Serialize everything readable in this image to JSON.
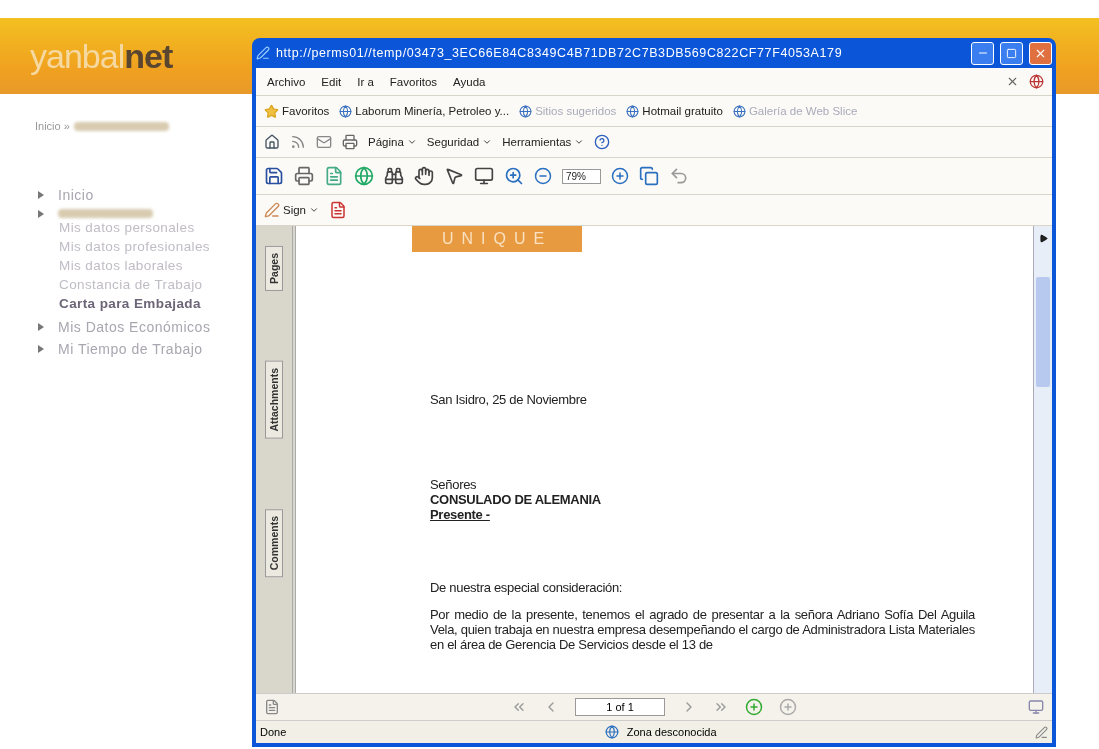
{
  "header": {
    "logo_light": "yanbal",
    "logo_bold": "net"
  },
  "breadcrumb": "Inicio »",
  "nav": [
    {
      "kind": "section",
      "label": "Inicio"
    },
    {
      "kind": "redacted",
      "children": [
        {
          "label": "Mis datos personales",
          "selected": false
        },
        {
          "label": "Mis datos profesionales",
          "selected": false
        },
        {
          "label": "Mis datos laborales",
          "selected": false
        },
        {
          "label": "Constancia de Trabajo",
          "selected": false
        },
        {
          "label": "Carta para Embajada",
          "selected": true
        }
      ]
    },
    {
      "kind": "section",
      "label": "Mis Datos Económicos"
    },
    {
      "kind": "section",
      "label": "Mi Tiempo de Trabajo"
    }
  ],
  "browser": {
    "title": "http://perms01//temp/03473_3EC66E84C8349C4B71DB72C7B3DB569C822CF77F4053A179",
    "menu": [
      "Archivo",
      "Edit",
      "Ir a",
      "Favoritos",
      "Ayuda"
    ],
    "favorites_label": "Favoritos",
    "favorites": [
      {
        "label": "Laborum Minería, Petroleo y...",
        "faded": false
      },
      {
        "label": "Sitios sugeridos",
        "faded": true
      },
      {
        "label": "Hotmail gratuito",
        "faded": false
      },
      {
        "label": "Galería de Web Slice",
        "faded": true
      }
    ],
    "commands": [
      "Página",
      "Seguridad",
      "Herramientas"
    ],
    "zoom": "79%",
    "sign": "Sign",
    "side_tabs": [
      "Pages",
      "Attachments",
      "Comments"
    ],
    "document": {
      "banner": "UNIQUE",
      "date": "San Isidro, 25 de Noviembre",
      "salutation": "Señores",
      "recipient": "CONSULADO DE ALEMANIA",
      "presente": "Presente -",
      "greeting": "De nuestra especial consideración:",
      "body": "Por medio de la presente, tenemos el agrado de presentar a la señora Adriano Sofía Del Aguila Vela, quien trabaja en nuestra empresa desempeñando el cargo de Administradora Lista Materiales en el área de Gerencia De Servicios desde el 13 de"
    },
    "page": "1 of 1",
    "status": "Done",
    "zone": "Zona desconocida"
  }
}
